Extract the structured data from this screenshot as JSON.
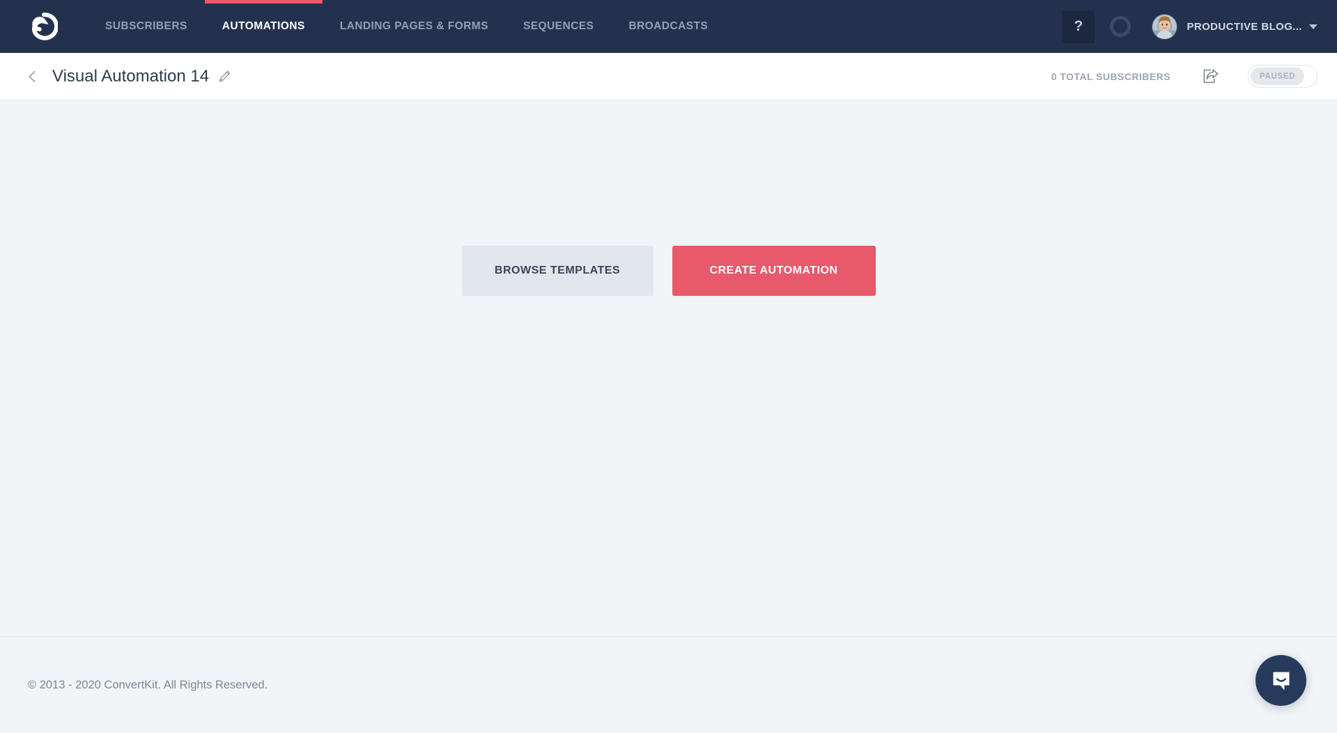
{
  "navbar": {
    "logo": "convertkit-logo",
    "items": [
      {
        "label": "Subscribers",
        "active": false
      },
      {
        "label": "Automations",
        "active": true
      },
      {
        "label": "Landing Pages & Forms",
        "active": false
      },
      {
        "label": "Sequences",
        "active": false
      },
      {
        "label": "Broadcasts",
        "active": false
      }
    ],
    "help_label": "?",
    "status_icon": "circle-ring-icon",
    "avatar_icon": "user-avatar-photo",
    "account_name": "Productive Blog...",
    "caret_icon": "chevron-down-icon",
    "background_color": "#24314e",
    "active_underline_color": "#e8596b"
  },
  "subheader": {
    "back_icon": "chevron-left-icon",
    "title": "Visual Automation 14",
    "edit_icon": "pencil-icon",
    "subscriber_count": "0 Total Subscribers",
    "share_icon": "share-icon",
    "toggle_state": "Paused"
  },
  "main": {
    "browse_templates_label": "Browse Templates",
    "create_automation_label": "Create Automation",
    "primary_color": "#e8596b",
    "secondary_color": "#e2e7ed",
    "background_color": "#f1f5f8"
  },
  "footer": {
    "copyright": "© 2013 - 2020 ConvertKit. All Rights Reserved."
  },
  "chat": {
    "launcher_icon": "chat-bubble-smile-icon",
    "color": "#263a5b"
  }
}
